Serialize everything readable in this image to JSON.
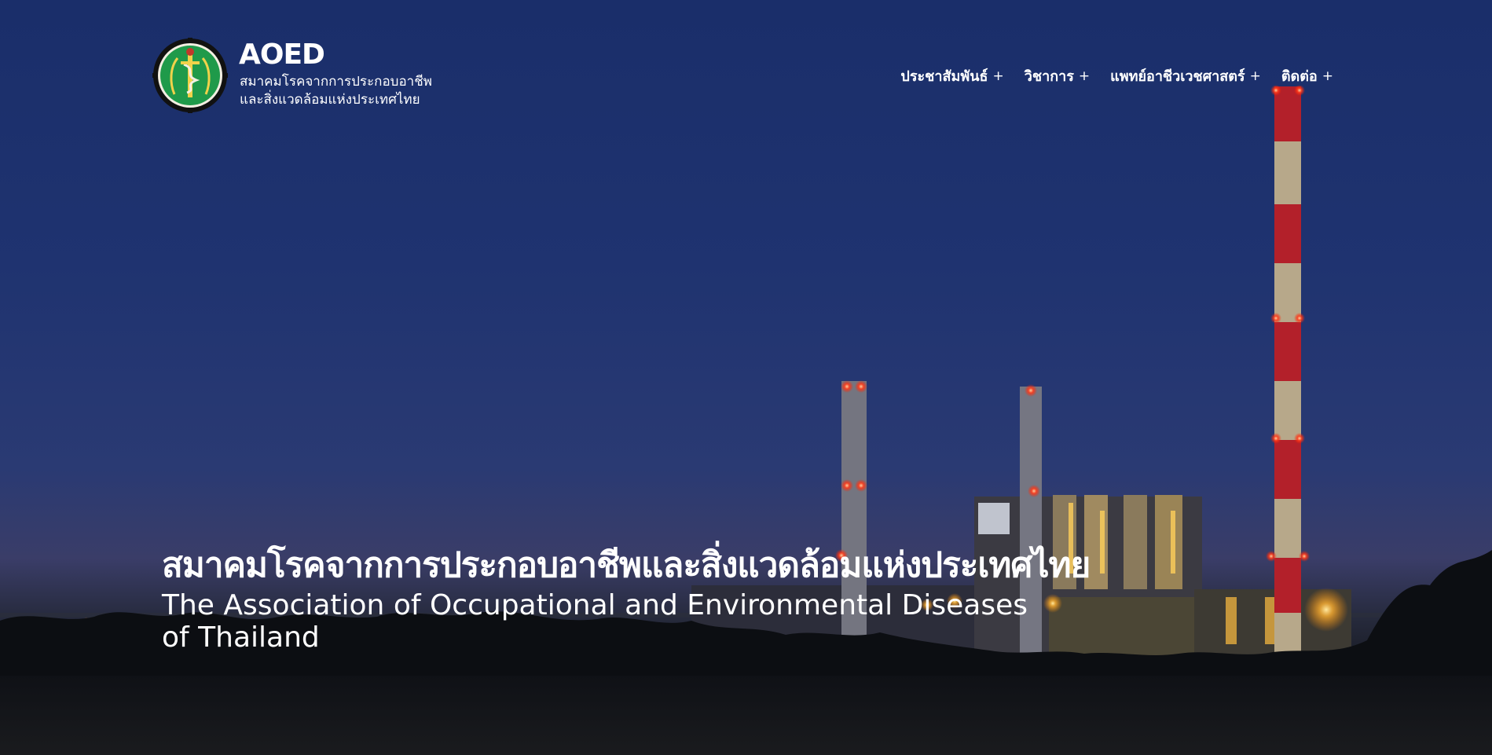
{
  "brand": {
    "title": "AOED",
    "subtitle_line1": "สมาคมโรคจากการประกอบอาชีพ",
    "subtitle_line2": "และสิ่งแวดล้อมแห่งประเทศไทย"
  },
  "nav": {
    "items": [
      {
        "label": "ประชาสัมพันธ์",
        "plus": "+"
      },
      {
        "label": "วิชาการ",
        "plus": "+"
      },
      {
        "label": "แพทย์อาชีวเวชศาสตร์",
        "plus": "+"
      },
      {
        "label": "ติดต่อ",
        "plus": "+"
      }
    ]
  },
  "hero": {
    "title_th": "สมาคมโรคจากการประกอบอาชีพและสิ่งแวดล้อมแห่งประเทศไทย",
    "title_en": "The Association of Occupational and Environmental Diseases of Thailand"
  },
  "colors": {
    "sky_top": "#1a2e6a",
    "sky_horizon": "#3a3d68",
    "logo_green": "#1f9a4a",
    "chimney_red": "#b3202a",
    "light_orange": "#ff9a2a"
  },
  "icons": {
    "logo": "aoed-emblem-icon"
  }
}
